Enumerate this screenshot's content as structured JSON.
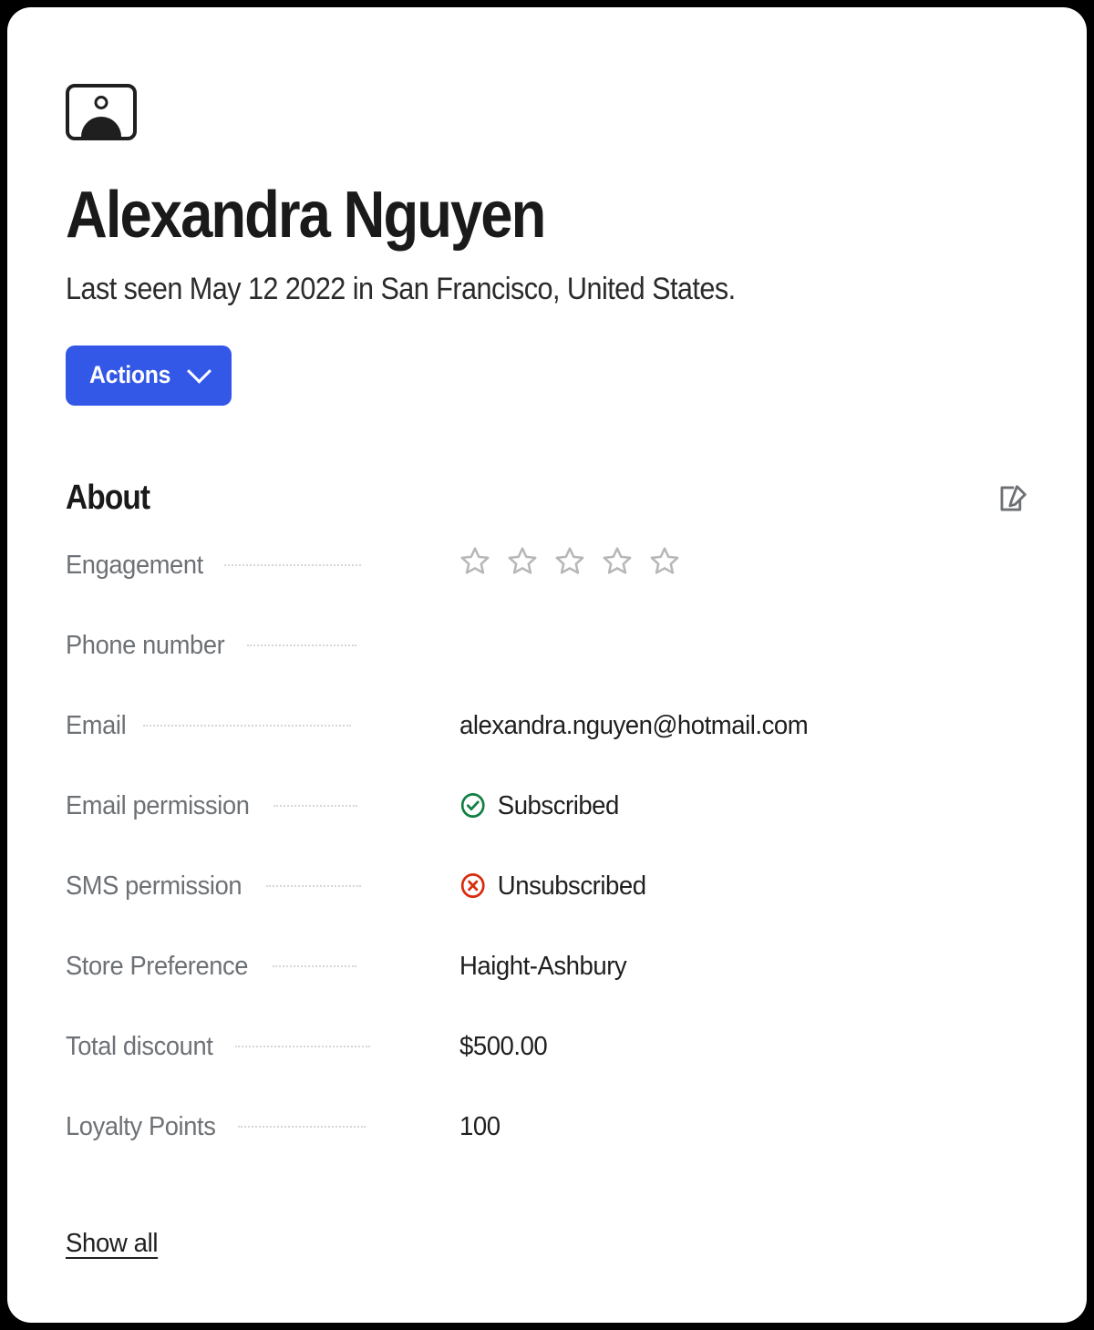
{
  "card": {
    "avatar_icon": "person-placeholder-icon",
    "title": "Alexandra Nguyen",
    "subtitle": "Last seen May 12 2022 in San Francisco, United States.",
    "actions_button": {
      "label": "Actions",
      "icon": "chevron-down-icon",
      "color": "#3358e8"
    }
  },
  "about": {
    "heading": "About",
    "edit_icon": "edit-pencil-icon",
    "fields": [
      {
        "label": "Engagement",
        "value": "",
        "type": "rating",
        "rating": 0,
        "max_rating": 5
      },
      {
        "label": "Phone number",
        "value": "",
        "type": "text"
      },
      {
        "label": "Email",
        "value": "alexandra.nguyen@hotmail.com",
        "type": "text"
      },
      {
        "label": "Email permission",
        "value": "Subscribed",
        "type": "status",
        "status_icon": "circle-check-icon",
        "status_color": "#108043"
      },
      {
        "label": "SMS permission",
        "value": "Unsubscribed",
        "type": "status",
        "status_icon": "circle-x-icon",
        "status_color": "#d82c0d"
      },
      {
        "label": "Store Preference",
        "value": "Haight-Ashbury",
        "type": "text"
      },
      {
        "label": "Total discount",
        "value": "$500.00",
        "type": "text"
      },
      {
        "label": "Loyalty Points",
        "value": "100",
        "type": "text"
      }
    ],
    "show_all_label": "Show all"
  }
}
